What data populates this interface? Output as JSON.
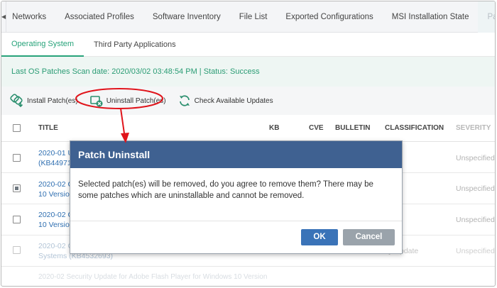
{
  "top_tabs": [
    "Networks",
    "Associated Profiles",
    "Software Inventory",
    "File List",
    "Exported Configurations",
    "MSI Installation State",
    "Patch Ma"
  ],
  "sub_tabs": [
    "Operating System",
    "Third Party Applications"
  ],
  "scan_status": "Last OS Patches Scan date: 2020/03/02 03:48:54 PM | Status: Success",
  "toolbar": {
    "install_label": "Install Patch(es)",
    "uninstall_label": "Uninstall Patch(es)",
    "check_label": "Check Available Updates"
  },
  "table": {
    "headers": {
      "title": "TITLE",
      "kb": "KB",
      "cve": "CVE",
      "bulletin": "BULLETIN",
      "classification": "CLASSIFICATION",
      "severity": "SEVERITY"
    },
    "rows": [
      {
        "title_1": "2020-01 U",
        "title_2": "(KB44971",
        "classification": "e",
        "severity": "Unspecified"
      },
      {
        "title_1": "2020-02 C",
        "title_2": "10 Version",
        "classification": "e",
        "severity": "Unspecified"
      },
      {
        "title_1": "2020-02 C",
        "title_2": "10 Version",
        "classification": "e",
        "severity": "Unspecified"
      },
      {
        "title_1": "2020-02 C",
        "title_2": "Systems (KB4532693)",
        "classification": "ity Update",
        "severity": "Unspecified"
      }
    ],
    "ghost_row": "2020-02 Security Update for Adobe Flash Player for Windows 10 Version"
  },
  "modal": {
    "title": "Patch Uninstall",
    "message": "Selected patch(es) will be removed, do you agree to remove them? There may be some patches which are uninstallable and cannot be removed.",
    "ok_label": "OK",
    "cancel_label": "Cancel"
  },
  "colors": {
    "accent_green": "#27a37a",
    "modal_header": "#3f6191",
    "ok_button": "#3a73b8",
    "cancel_button": "#9aa3ab",
    "annotation_red": "#e0141b"
  }
}
